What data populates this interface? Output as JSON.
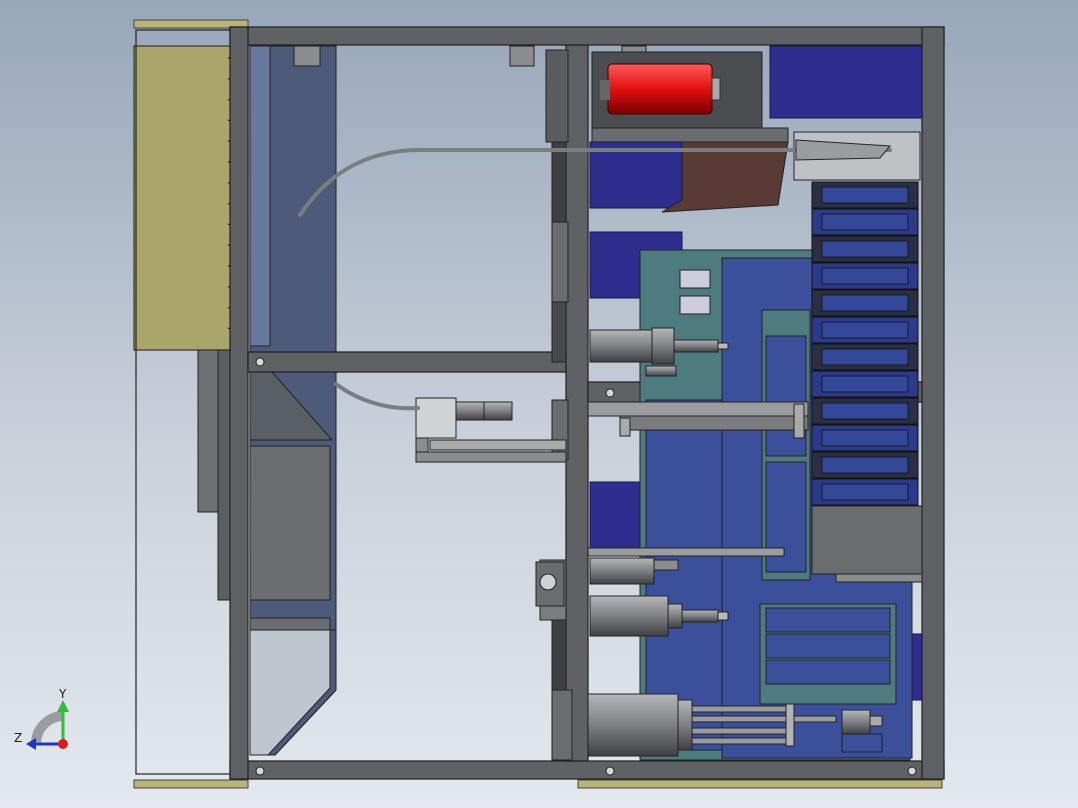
{
  "viewport": {
    "background_top": "#97a6b9",
    "background_bottom": "#e4e8ee"
  },
  "triad": {
    "y_label": "Y",
    "z_label": "Z",
    "y_color": "#2bbf3a",
    "z_color": "#1a36c9",
    "x_color": "#d81b1b"
  },
  "model": {
    "description_visible": false,
    "palette": {
      "frame": "#5f6164",
      "frame_dark": "#3a3c3f",
      "panel_olive": "#a9a56b",
      "panel_blue": "#2e2e8f",
      "panel_slate": "#4d5a7a",
      "plate_teal": "#4d7b80",
      "plate_navy": "#3c4f9a",
      "cylinder_red": "#e01010",
      "motor_gray": "#808285",
      "chain_dark": "#2a2f45",
      "hose": "#7a7d80"
    }
  }
}
